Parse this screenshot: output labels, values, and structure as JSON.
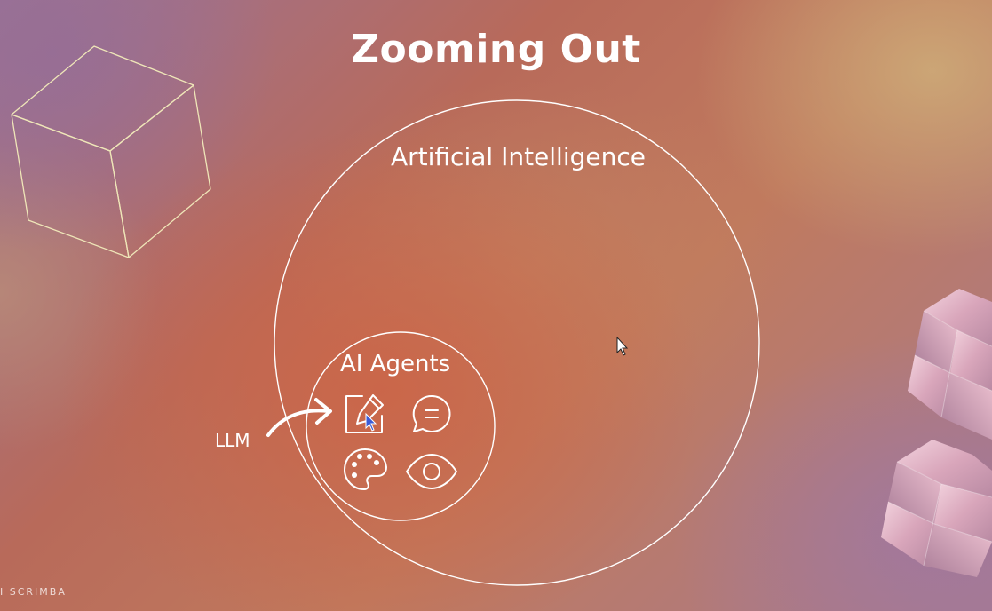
{
  "slide": {
    "title": "Zooming Out",
    "outer_circle_label": "Artificial Intelligence",
    "inner_circle_label": "AI Agents",
    "arrow_label": "LLM",
    "brand": "I SCRIMBA"
  },
  "icons": [
    "edit-icon",
    "chat-bubble-icon",
    "palette-icon",
    "eye-icon"
  ],
  "colors": {
    "text": "#ffffff",
    "lines": "#ffffff",
    "cube_outline": "#efe6b8",
    "cursor_accent": "#3b5bd6"
  }
}
